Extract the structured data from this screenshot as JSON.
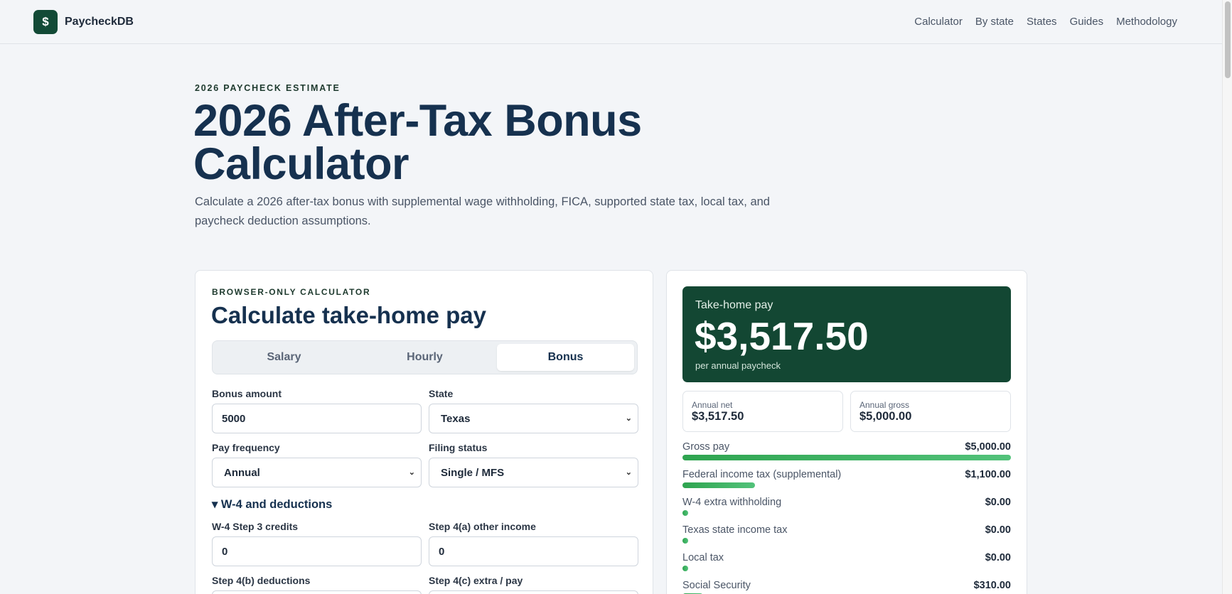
{
  "header": {
    "logo_glyph": "$",
    "brand": "PaycheckDB",
    "nav": [
      "Calculator",
      "By state",
      "States",
      "Guides",
      "Methodology"
    ]
  },
  "hero": {
    "eyebrow": "2026 PAYCHECK ESTIMATE",
    "title": "2026 After-Tax Bonus Calculator",
    "lead": "Calculate a 2026 after-tax bonus with supplemental wage withholding, FICA, supported state tax, local tax, and paycheck deduction assumptions."
  },
  "calculator": {
    "eyebrow": "BROWSER-ONLY CALCULATOR",
    "title": "Calculate take-home pay",
    "modes": [
      "Salary",
      "Hourly",
      "Bonus"
    ],
    "active_mode": "Bonus",
    "fields": {
      "bonus_amount": {
        "label": "Bonus amount",
        "value": "5000"
      },
      "state": {
        "label": "State",
        "value": "Texas"
      },
      "pay_frequency": {
        "label": "Pay frequency",
        "value": "Annual"
      },
      "filing_status": {
        "label": "Filing status",
        "value": "Single / MFS"
      },
      "w4_step3": {
        "label": "W-4 Step 3 credits",
        "value": "0"
      },
      "step4a": {
        "label": "Step 4(a) other income",
        "value": "0"
      },
      "step4b": {
        "label": "Step 4(b) deductions",
        "value": ""
      },
      "step4c": {
        "label": "Step 4(c) extra / pay",
        "value": ""
      }
    },
    "w4_toggle": "▾ W-4 and deductions"
  },
  "results": {
    "take_home_label": "Take-home pay",
    "take_home_amount": "$3,517.50",
    "take_home_sub": "per annual paycheck",
    "annual_net_label": "Annual net",
    "annual_net_value": "$3,517.50",
    "annual_gross_label": "Annual gross",
    "annual_gross_value": "$5,000.00",
    "breakdown": [
      {
        "label": "Gross pay",
        "value": "$5,000.00",
        "fraction": 1.0
      },
      {
        "label": "Federal income tax (supplemental)",
        "value": "$1,100.00",
        "fraction": 0.22
      },
      {
        "label": "W-4 extra withholding",
        "value": "$0.00",
        "fraction": 0
      },
      {
        "label": "Texas state income tax",
        "value": "$0.00",
        "fraction": 0
      },
      {
        "label": "Local tax",
        "value": "$0.00",
        "fraction": 0
      },
      {
        "label": "Social Security",
        "value": "$310.00",
        "fraction": 0.062
      }
    ]
  },
  "colors": {
    "brand_green": "#134733",
    "accent_green": "#2ea44f",
    "heading_navy": "#16314f"
  }
}
